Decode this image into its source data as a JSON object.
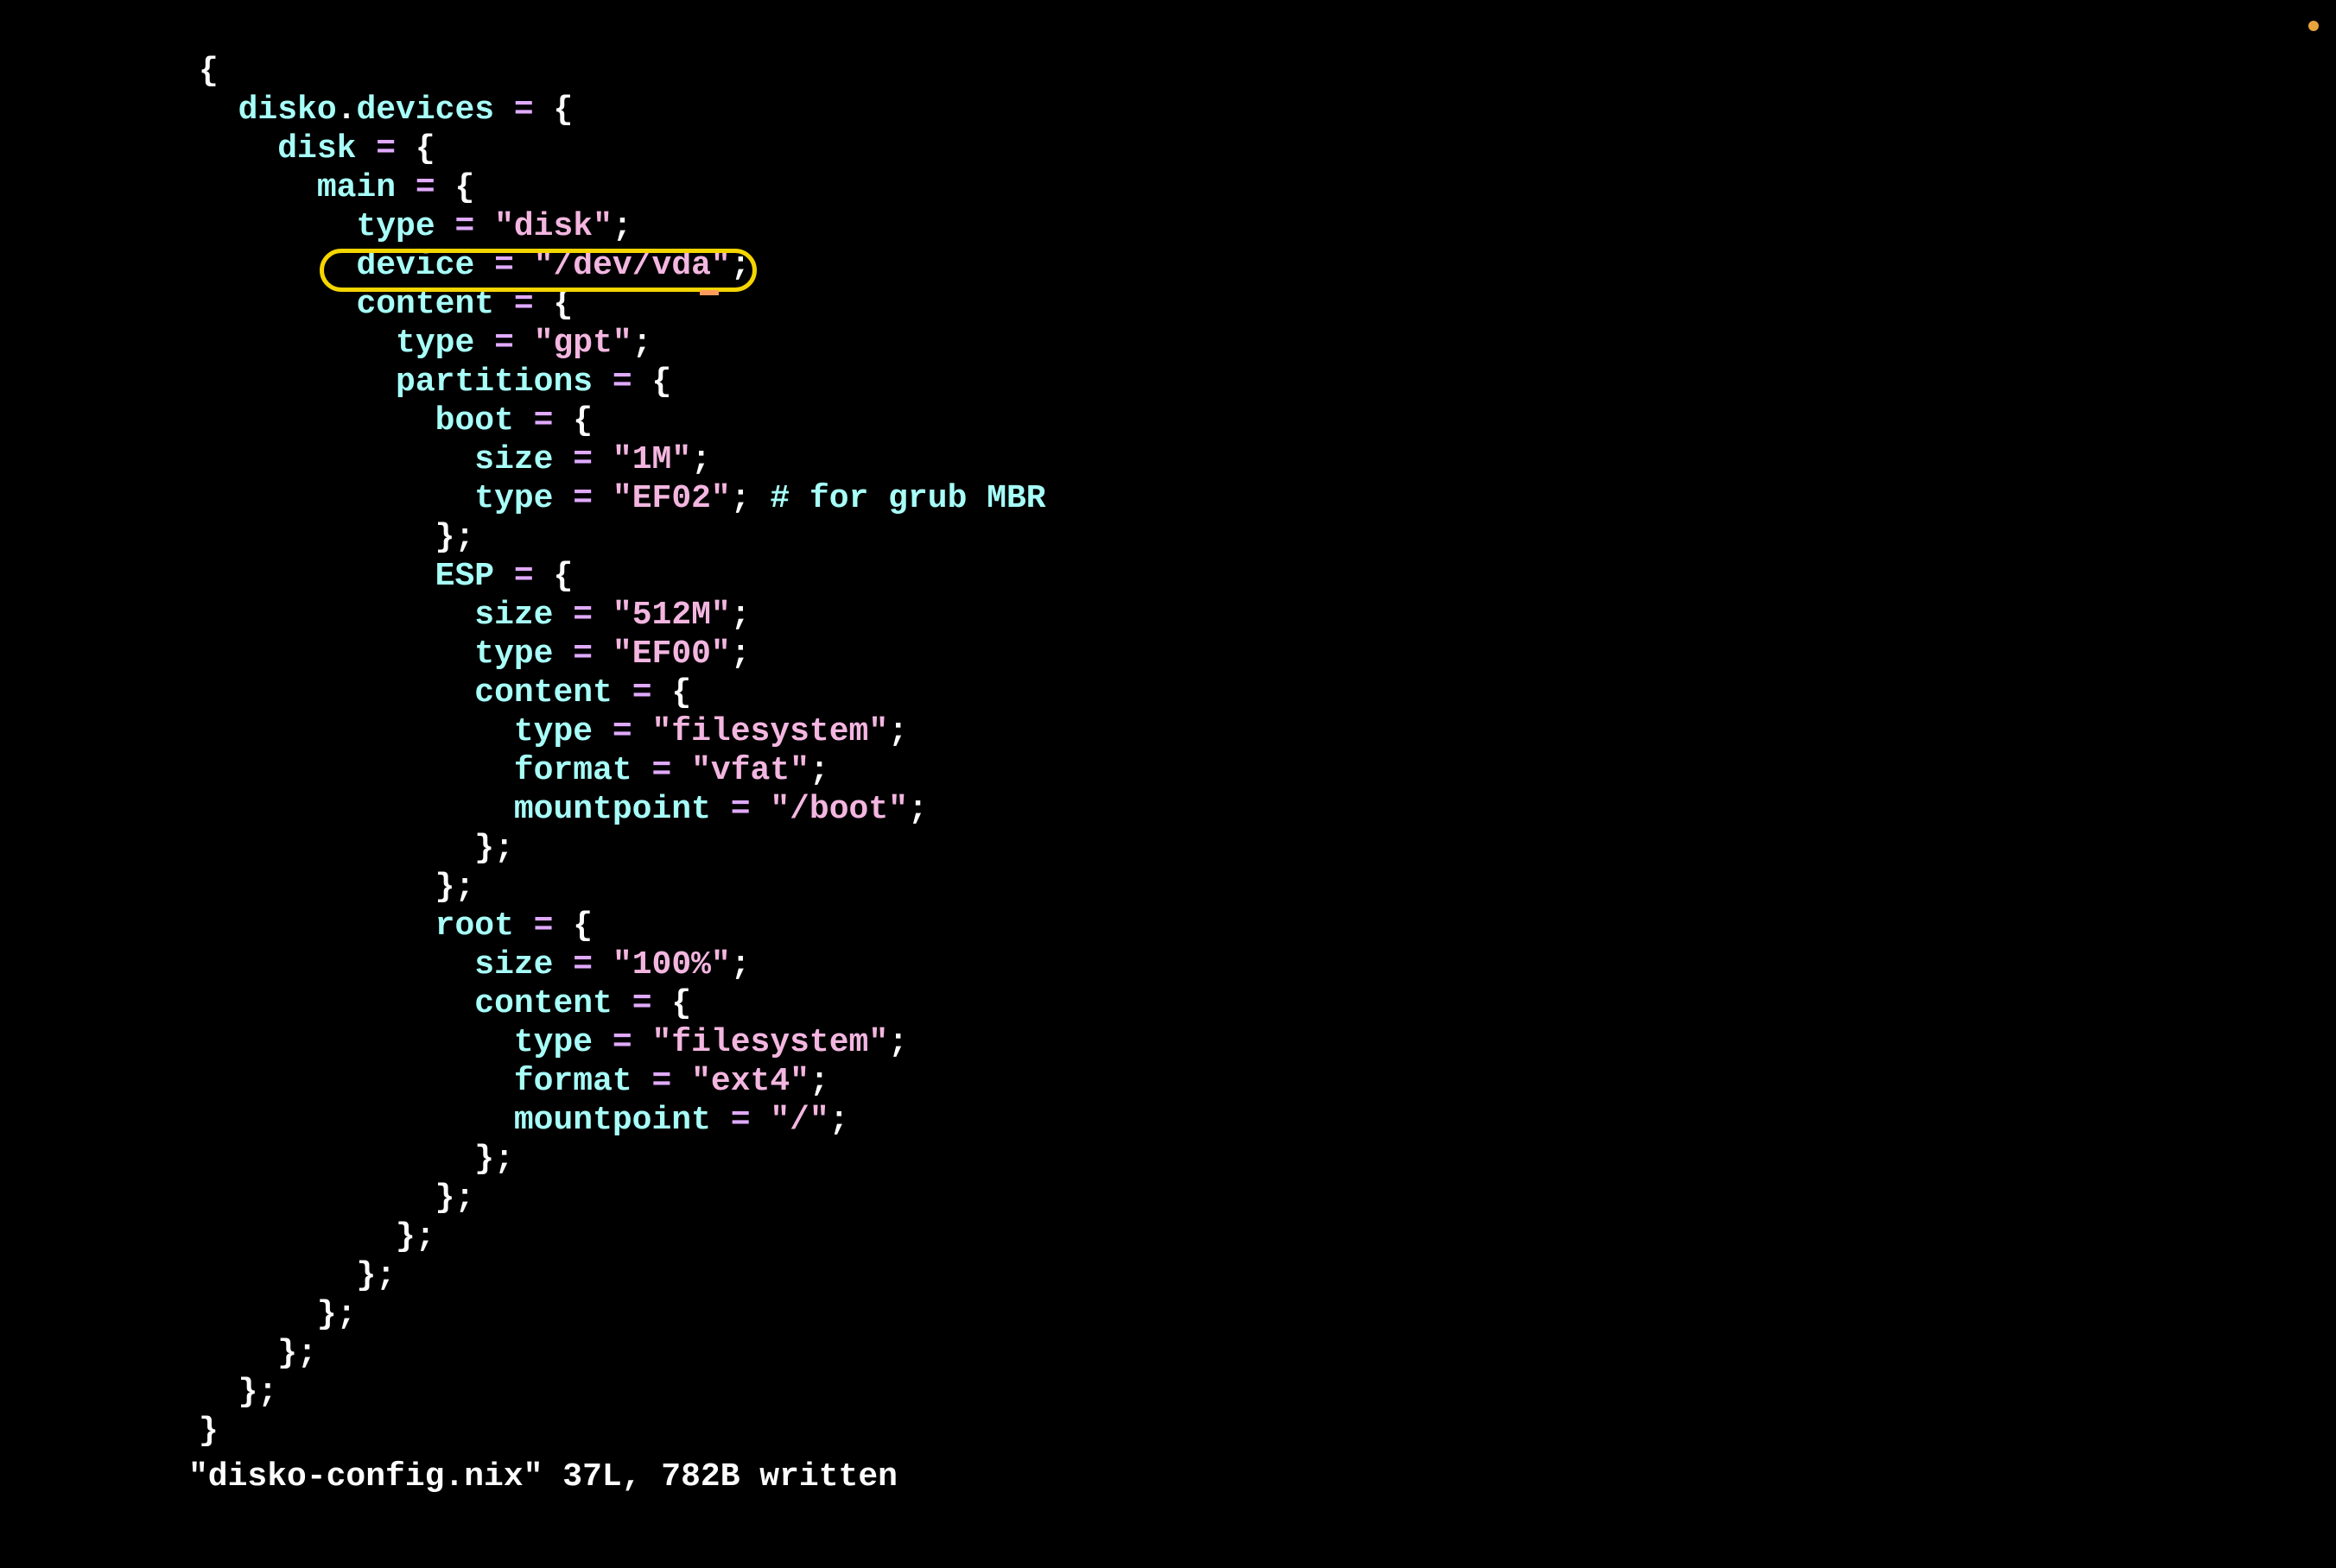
{
  "status": {
    "filename": "disko-config.nix",
    "line_count": "37L",
    "bytes": "782B",
    "state": "written"
  },
  "file": {
    "root_key1": "disko",
    "root_key2": "devices",
    "disk_key": "disk",
    "main_key": "main",
    "type_key": "type",
    "disk_type": "disk",
    "device_key": "device",
    "device_value": "/dev/vda",
    "content_key": "content",
    "gpt_type": "gpt",
    "partitions_key": "partitions",
    "boot_key": "boot",
    "size_key": "size",
    "boot_size": "1M",
    "boot_type": "EF02",
    "boot_comment": "for grub MBR",
    "esp_key": "ESP",
    "esp_size": "512M",
    "esp_type": "EF00",
    "fs_type": "filesystem",
    "format_key": "format",
    "vfat": "vfat",
    "mountpoint_key": "mountpoint",
    "boot_mount": "/boot",
    "root_key": "root",
    "root_size": "100%",
    "ext4": "ext4",
    "root_mount": "/"
  },
  "colors": {
    "punct": "#fdfdfd",
    "ident": "#a7fff8",
    "eq": "#e0aaff",
    "string": "#f3b6e0",
    "highlight": "#f5d500",
    "cursor": "#ff9c5c",
    "indicator": "#e8a43c"
  }
}
